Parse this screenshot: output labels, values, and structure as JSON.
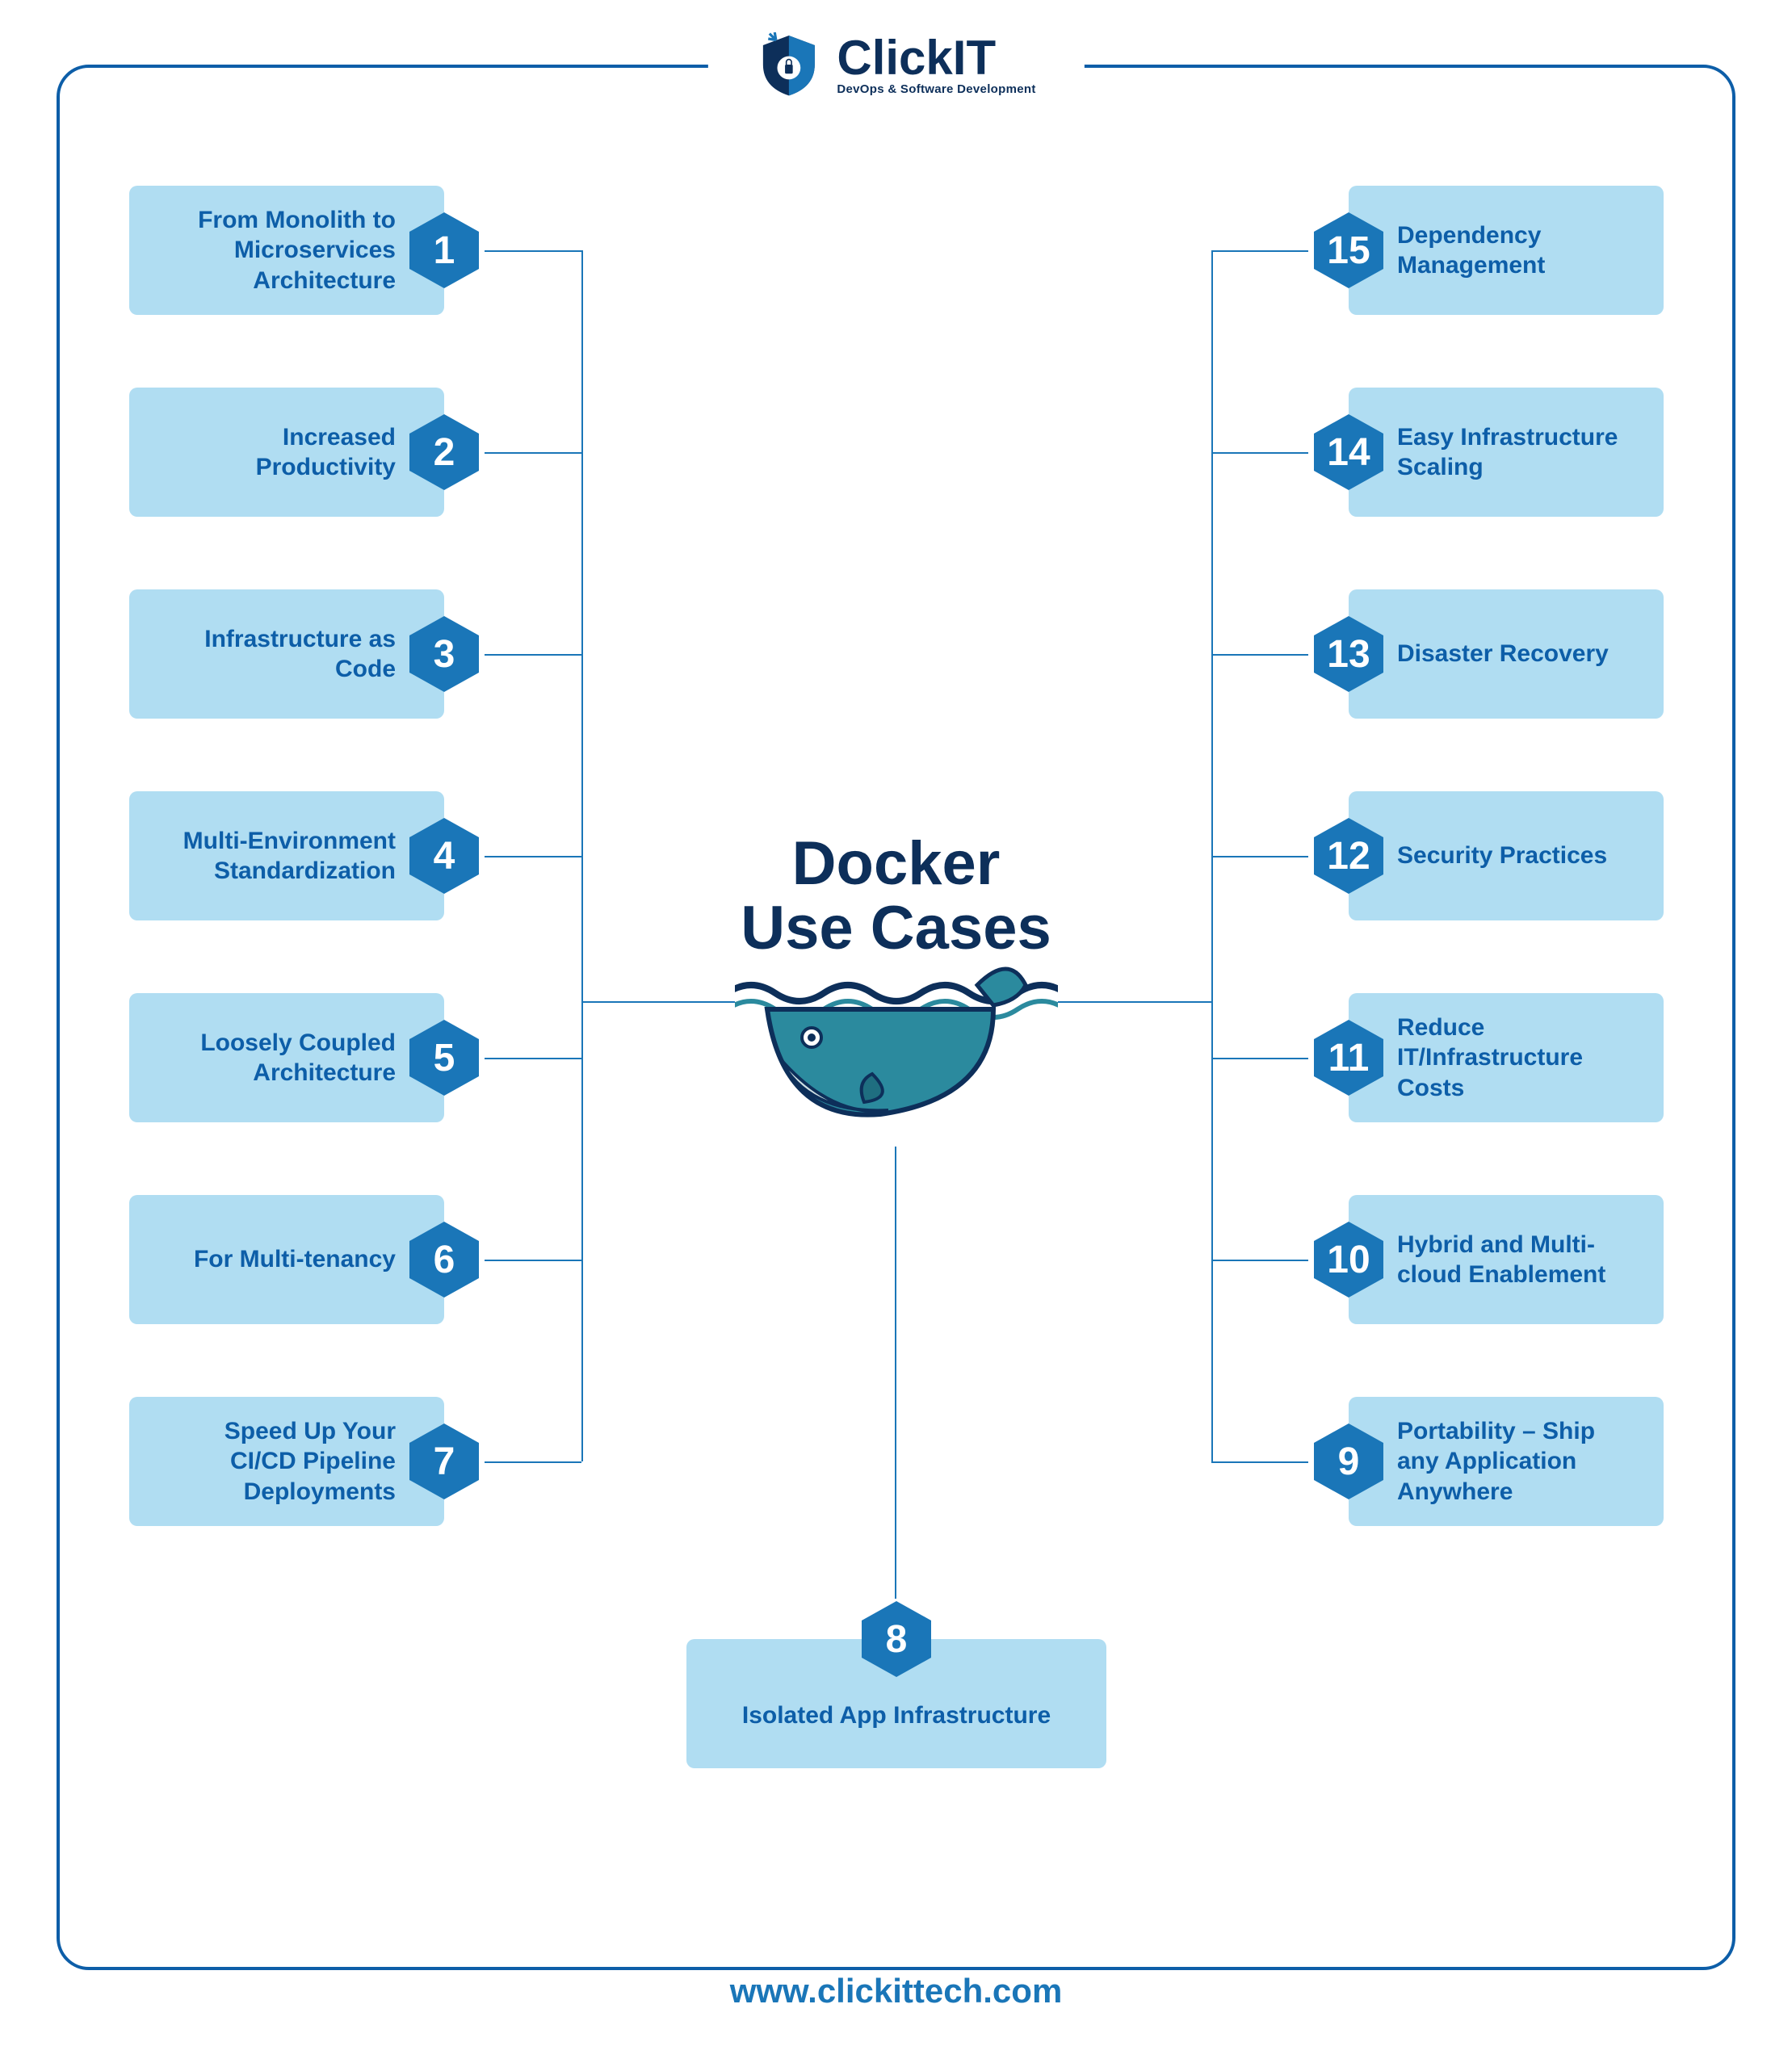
{
  "brand": {
    "name": "ClickIT",
    "tagline": "DevOps & Software Development"
  },
  "title_line1": "Docker",
  "title_line2": "Use Cases",
  "footer_url": "www.clickittech.com",
  "colors": {
    "border": "#0d5ea8",
    "card_bg": "#b0ddf2",
    "badge": "#1a76b8",
    "text_dark": "#0d2f5a"
  },
  "items": {
    "1": "From Monolith to Microservices Architecture",
    "2": "Increased Productivity",
    "3": "Infrastructure as Code",
    "4": "Multi-Environment Standardization",
    "5": "Loosely Coupled Architecture",
    "6": "For Multi-tenancy",
    "7": "Speed Up Your CI/CD Pipeline Deployments",
    "8": "Isolated App Infrastructure",
    "9": "Portability – Ship any Application Anywhere",
    "10": "Hybrid and Multi-cloud Enablement",
    "11": "Reduce IT/Infrastructure Costs",
    "12": "Security Practices",
    "13": "Disaster Recovery",
    "14": "Easy Infrastructure Scaling",
    "15": "Dependency Management"
  }
}
